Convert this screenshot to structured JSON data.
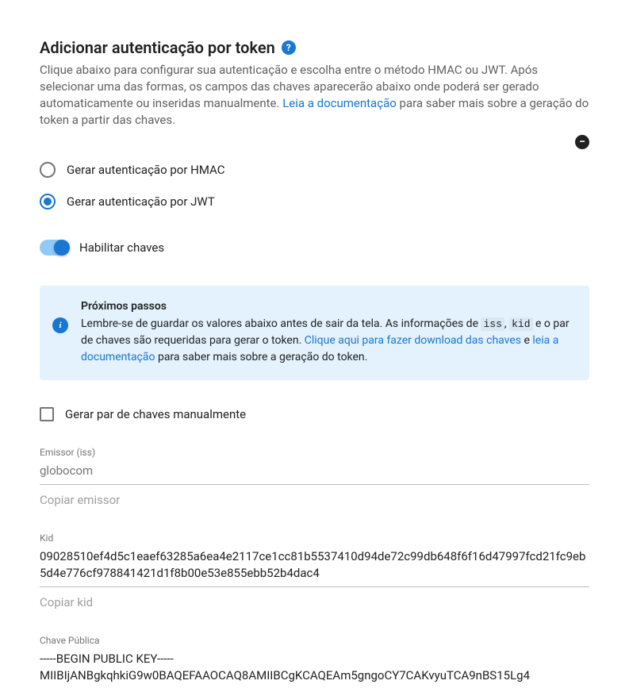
{
  "header": {
    "title": "Adicionar autenticação por token",
    "description_prefix": "Clique abaixo para configurar sua autenticação e escolha entre o método HMAC ou JWT. Após selecionar uma das formas, os campos das chaves aparecerão abaixo onde poderá ser gerado automaticamente ou inseridas manualmente. ",
    "doc_link": "Leia a documentação",
    "description_suffix": " para saber mais sobre a geração do token a partir das chaves."
  },
  "radio": {
    "hmac": "Gerar autenticação por HMAC",
    "jwt": "Gerar autenticação por JWT"
  },
  "toggle": {
    "label": "Habilitar chaves"
  },
  "info": {
    "title": "Próximos passos",
    "text_prefix": "Lembre-se de guardar os valores abaixo antes de sair da tela. As informações de ",
    "iss": "iss",
    "comma": ", ",
    "kid": "kid",
    "text_mid": " e o par de chaves são requeridas para gerar o token. ",
    "download_link": "Clique aqui para fazer download das chaves",
    "and": " e ",
    "doc_link": "leia a documentação",
    "text_suffix": " para saber mais sobre a geração do token."
  },
  "checkbox": {
    "label": "Gerar par de chaves manualmente"
  },
  "fields": {
    "emissor": {
      "label": "Emissor (iss)",
      "value": "globocom",
      "copy": "Copiar emissor"
    },
    "kid": {
      "label": "Kid",
      "value": "09028510ef4d5c1eaef63285a6ea4e2117ce1cc81b5537410d94de72c99db648f6f16d47997fcd21fc9eb5d4e776cf978841421d1f8b00e53e855ebb52b4dac4",
      "copy": "Copiar kid"
    },
    "pubkey": {
      "label": "Chave Pública",
      "line1": "-----BEGIN PUBLIC KEY-----",
      "line2": "MIIBIjANBgkqhkiG9w0BAQEFAAOCAQ8AMIIBCgKCAQEAm5gngoCY7CAKvyuTCA9nBS15Lg4"
    }
  }
}
